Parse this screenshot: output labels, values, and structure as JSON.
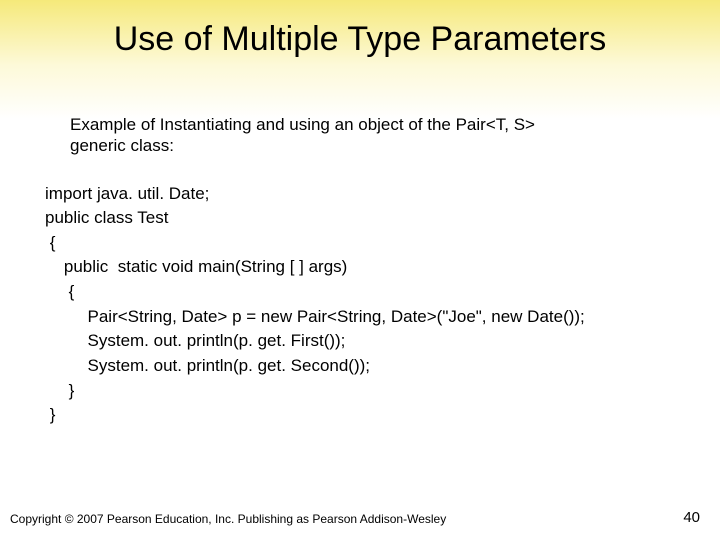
{
  "title": "Use of Multiple Type Parameters",
  "subtitle_line1": "Example of Instantiating and using an object of the Pair<T, S>",
  "subtitle_line2": "generic class:",
  "code": "import java. util. Date;\npublic class Test\n {\n    public  static void main(String [ ] args)\n     {\n         Pair<String, Date> p = new Pair<String, Date>(\"Joe\", new Date());\n         System. out. println(p. get. First());\n         System. out. println(p. get. Second());\n     }\n }",
  "copyright": "Copyright © 2007 Pearson Education, Inc. Publishing as Pearson Addison-Wesley",
  "page_number": "40"
}
